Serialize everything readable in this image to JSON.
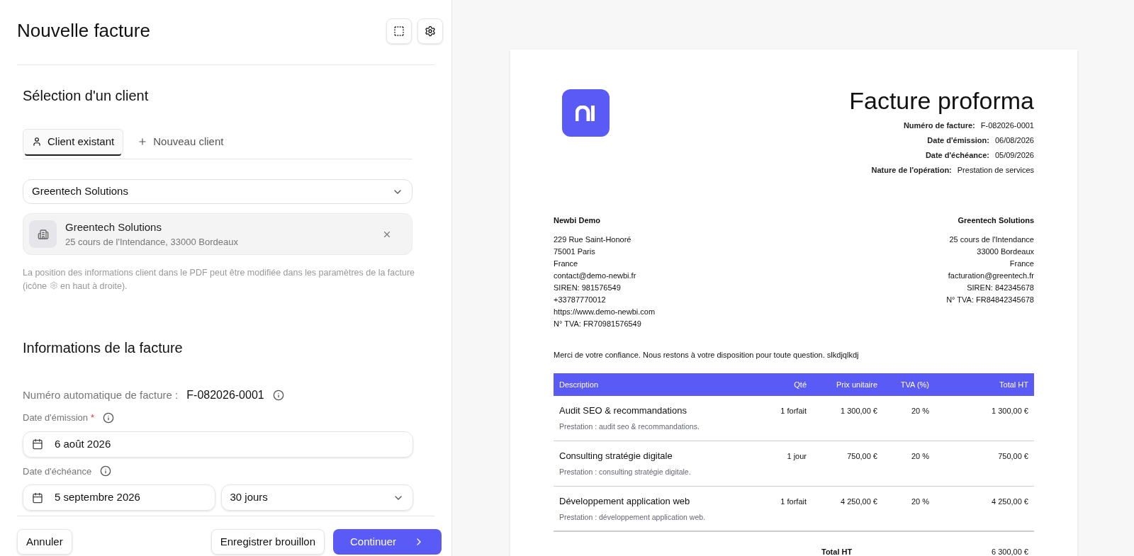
{
  "header": {
    "title": "Nouvelle facture"
  },
  "client_section": {
    "title": "Sélection d'un client",
    "tabs": [
      {
        "label": "Client existant",
        "kind": "user",
        "selected": true
      },
      {
        "label": "Nouveau client",
        "kind": "plus",
        "selected": false
      }
    ],
    "select": {
      "value": "Greentech Solutions"
    },
    "client_card": {
      "name": "Greentech Solutions",
      "address": "25 cours de l'Intendance, 33000 Bordeaux"
    },
    "hint_before": "La position des informations client dans le PDF peut être modifiée dans les paramètres de la facture (icône",
    "hint_after": "en haut à droite)."
  },
  "invoice_section": {
    "title": "Informations de la facture",
    "number_label": "Numéro automatique de facture :",
    "number_value": "F-082026-0001",
    "required_mark": "*",
    "issue_date": {
      "label": "Date d'émission",
      "required": true,
      "value": "6 août 2026"
    },
    "due_date": {
      "label": "Date d'échéance",
      "required": false,
      "value": "5 septembre 2026",
      "term": "30 jours"
    }
  },
  "footer": {
    "cancel": "Annuler",
    "draft": "Enregistrer brouillon",
    "continue": "Continuer"
  },
  "preview": {
    "title": "Facture proforma",
    "meta": [
      {
        "label": "Numéro de facture:",
        "value": "F-082026-0001"
      },
      {
        "label": "Date d'émission:",
        "value": "06/08/2026"
      },
      {
        "label": "Date d'échéance:",
        "value": "05/09/2026"
      },
      {
        "label": "Nature de l'opération:",
        "value": "Prestation de services"
      }
    ],
    "seller": {
      "name": "Newbi Demo",
      "lines": [
        "229 Rue Saint-Honoré",
        "75001 Paris",
        "France",
        "contact@demo-newbi.fr",
        "SIREN: 981576549",
        "+33787770012",
        "https://www.demo-newbi.com",
        "N° TVA: FR70981576549"
      ]
    },
    "buyer": {
      "name": "Greentech Solutions",
      "lines": [
        "25 cours de l'Intendance",
        "33000 Bordeaux",
        "France",
        "facturation@greentech.fr",
        "SIREN: 842345678",
        "N° TVA: FR84842345678"
      ]
    },
    "message": "Merci de votre confiance. Nous restons à votre disposition pour toute question. slkdjqlkdj",
    "columns": [
      "Description",
      "Qté",
      "Prix unitaire",
      "TVA (%)",
      "Total HT"
    ],
    "rows": [
      {
        "title": "Audit SEO & recommandations",
        "detail": "Prestation : audit seo & recommandations.",
        "qty": "1 forfait",
        "price": "1 300,00 €",
        "vat": "20 %",
        "total": "1 300,00 €"
      },
      {
        "title": "Consulting stratégie digitale",
        "detail": "Prestation : consulting stratégie digitale.",
        "qty": "1 jour",
        "price": "750,00 €",
        "vat": "20 %",
        "total": "750,00 €"
      },
      {
        "title": "Développement application web",
        "detail": "Prestation : développement application web.",
        "qty": "1 forfait",
        "price": "4 250,00 €",
        "vat": "20 %",
        "total": "4 250,00 €"
      }
    ],
    "totals": [
      {
        "label": "Total HT",
        "value": "6 300,00 €"
      }
    ]
  }
}
